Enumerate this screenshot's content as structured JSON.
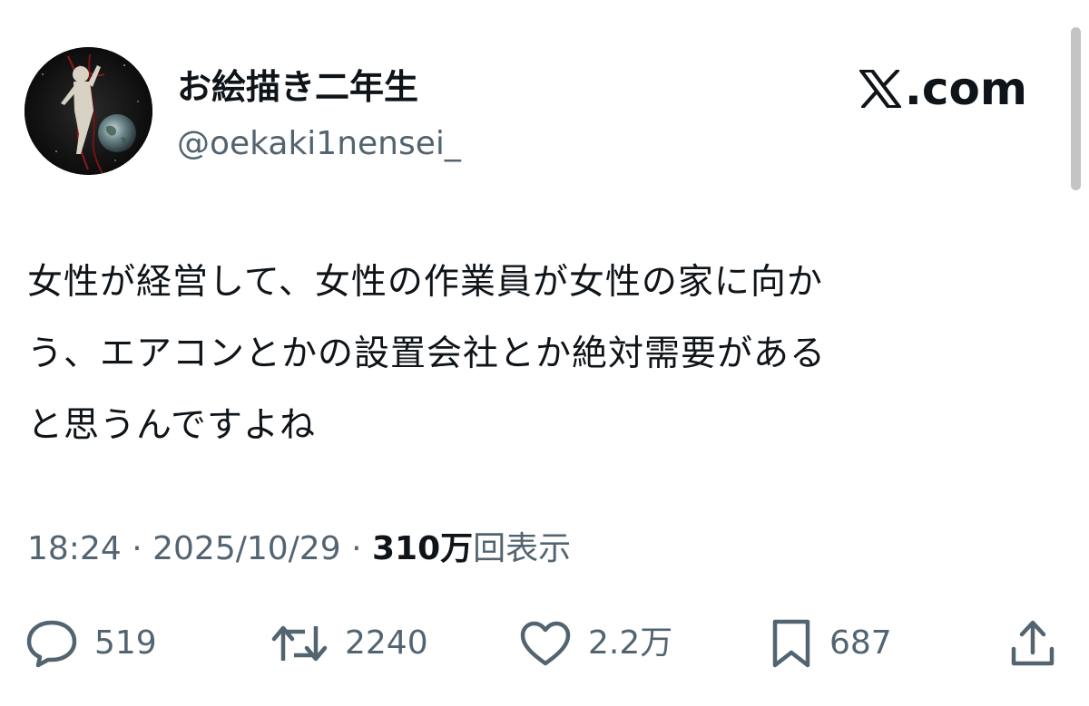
{
  "author": {
    "display_name": "お絵描き二年生",
    "handle": "@oekaki1nensei_"
  },
  "brand": {
    "label": ".com",
    "icon": "x-logo-icon"
  },
  "tweet": {
    "text": "女性が経営して、女性の作業員が女性の家に向か\nう、エアコンとかの設置会社とか絶対需要がある\nと思うんですよね",
    "time": "18:24",
    "separator": "·",
    "date": "2025/10/29",
    "views_count": "310万",
    "views_label": "回表示"
  },
  "actions": {
    "replies": "519",
    "retweets": "2240",
    "likes": "2.2万",
    "bookmarks": "687"
  },
  "icons": {
    "reply": "speech-bubble-icon",
    "retweet": "retweet-arrows-icon",
    "like": "heart-icon",
    "bookmark": "bookmark-icon",
    "share": "share-upload-icon"
  },
  "colors": {
    "text_primary": "#0f1419",
    "text_secondary": "#536471",
    "background": "#ffffff"
  }
}
